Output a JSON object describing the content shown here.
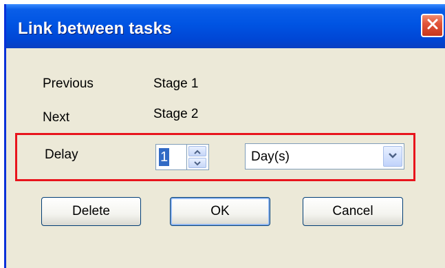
{
  "window": {
    "title": "Link between tasks",
    "close_icon": "close-icon"
  },
  "fields": {
    "previous_label": "Previous",
    "previous_value": "Stage 1",
    "next_label": "Next",
    "next_value": "Stage 2",
    "delay_label": "Delay",
    "delay_value": "1",
    "delay_unit": "Day(s)"
  },
  "buttons": {
    "delete_label": "Delete",
    "ok_label": "OK",
    "cancel_label": "Cancel"
  },
  "colors": {
    "titlebar": "#0054e3",
    "dialog_bg": "#ece9d8",
    "highlight_border": "#e8141c",
    "selection": "#316ac5"
  }
}
